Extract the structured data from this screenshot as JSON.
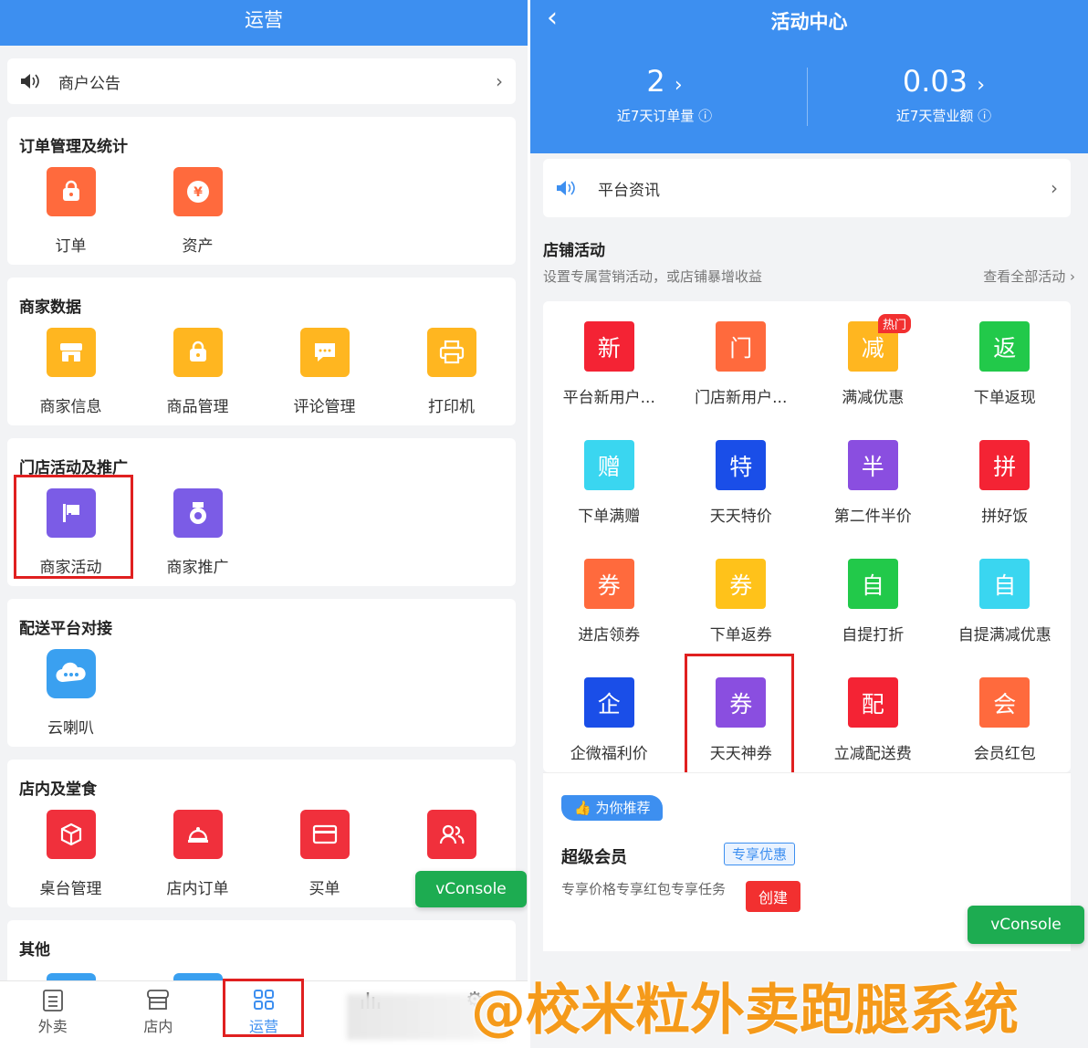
{
  "left": {
    "header_title": "运营",
    "notice": "商户公告",
    "sections": [
      {
        "title": "订单管理及统计",
        "items": [
          {
            "label": "订单",
            "color": "#ff6a3d",
            "icon": "bag-icon"
          },
          {
            "label": "资产",
            "color": "#ff6a3d",
            "icon": "coin-icon"
          }
        ]
      },
      {
        "title": "商家数据",
        "items": [
          {
            "label": "商家信息",
            "color": "#ffb620",
            "icon": "store-icon"
          },
          {
            "label": "商品管理",
            "color": "#ffb620",
            "icon": "bag-icon"
          },
          {
            "label": "评论管理",
            "color": "#ffb620",
            "icon": "comment-icon"
          },
          {
            "label": "打印机",
            "color": "#ffb620",
            "icon": "printer-icon"
          }
        ]
      },
      {
        "title": "门店活动及推广",
        "items": [
          {
            "label": "商家活动",
            "color": "#7b5ce6",
            "icon": "flag-icon"
          },
          {
            "label": "商家推广",
            "color": "#7b5ce6",
            "icon": "medal-icon"
          }
        ]
      },
      {
        "title": "配送平台对接",
        "items": [
          {
            "label": "云喇叭",
            "color": "#3aa0f0",
            "icon": "cloud-chat-icon"
          }
        ]
      },
      {
        "title": "店内及堂食",
        "items": [
          {
            "label": "桌台管理",
            "color": "#f0303c",
            "icon": "cube-icon"
          },
          {
            "label": "店内订单",
            "color": "#f0303c",
            "icon": "bell-icon"
          },
          {
            "label": "买单",
            "color": "#f0303c",
            "icon": "card-icon"
          },
          {
            "label": "",
            "color": "#f0303c",
            "icon": "users-icon"
          }
        ]
      },
      {
        "title": "其他",
        "items": []
      }
    ],
    "vconsole": "vConsole",
    "tabs": [
      {
        "label": "外卖",
        "icon": "list-icon"
      },
      {
        "label": "店内",
        "icon": "store-icon"
      },
      {
        "label": "运营",
        "icon": "grid-icon"
      },
      {
        "label": "",
        "icon": "chart-icon"
      },
      {
        "label": "",
        "icon": "gear-icon"
      }
    ]
  },
  "right": {
    "header_title": "活动中心",
    "stats": [
      {
        "value": "2",
        "label": "近7天订单量"
      },
      {
        "value": "0.03",
        "label": "近7天营业额"
      }
    ],
    "notice": "平台资讯",
    "shop_title": "店铺活动",
    "shop_subtitle": "设置专属营销活动，或店铺暴增收益",
    "view_all": "查看全部活动",
    "activities": [
      {
        "char": "新",
        "label": "平台新用户...",
        "color": "#f42334"
      },
      {
        "char": "门",
        "label": "门店新用户...",
        "color": "#ff6a3d"
      },
      {
        "char": "减",
        "label": "满减优惠",
        "color": "#ffb620",
        "badge": "热门"
      },
      {
        "char": "返",
        "label": "下单返现",
        "color": "#22c94a"
      },
      {
        "char": "赠",
        "label": "下单满赠",
        "color": "#3ad6f0"
      },
      {
        "char": "特",
        "label": "天天特价",
        "color": "#1a4ee8"
      },
      {
        "char": "半",
        "label": "第二件半价",
        "color": "#8a4ee0"
      },
      {
        "char": "拼",
        "label": "拼好饭",
        "color": "#f42334"
      },
      {
        "char": "券",
        "label": "进店领券",
        "color": "#ff6a3d"
      },
      {
        "char": "券",
        "label": "下单返券",
        "color": "#ffc21a"
      },
      {
        "char": "自",
        "label": "自提打折",
        "color": "#22c94a"
      },
      {
        "char": "自",
        "label": "自提满减优惠",
        "color": "#3ad6f0"
      },
      {
        "char": "企",
        "label": "企微福利价",
        "color": "#1a4ee8"
      },
      {
        "char": "券",
        "label": "天天神券",
        "color": "#8a4ee0"
      },
      {
        "char": "配",
        "label": "立减配送费",
        "color": "#f42334"
      },
      {
        "char": "会",
        "label": "会员红包",
        "color": "#ff6a3d"
      }
    ],
    "reco_tag": "为你推荐",
    "super_title": "超级会员",
    "super_badge": "专享优惠",
    "super_desc": "专享价格专享红包专享任务",
    "create": "创建",
    "vconsole": "vConsole"
  },
  "watermark": "@校米粒外卖跑腿系统"
}
